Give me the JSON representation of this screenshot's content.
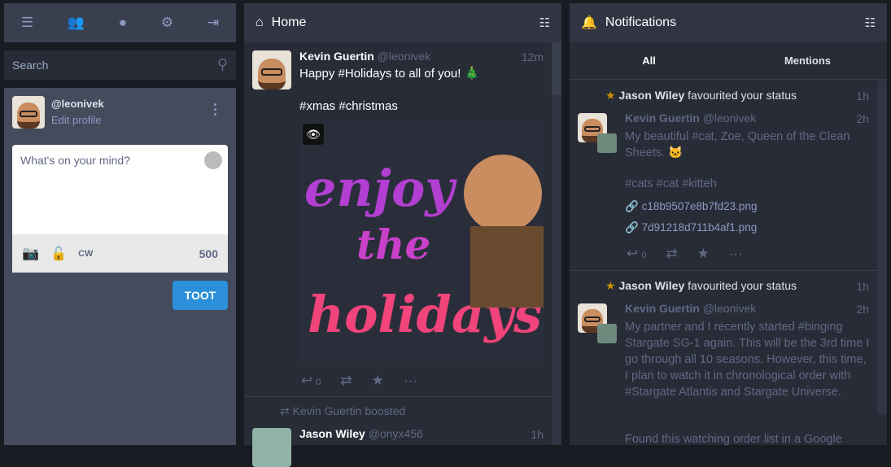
{
  "nav": {
    "icons": [
      "menu-icon",
      "users-icon",
      "globe-icon",
      "gear-icon",
      "logout-icon"
    ]
  },
  "search": {
    "placeholder": "Search"
  },
  "profile": {
    "handle": "@leonivek",
    "edit": "Edit profile"
  },
  "compose": {
    "placeholder": "What's on your mind?",
    "cw": "CW",
    "count": "500",
    "toot": "TOOT"
  },
  "home": {
    "title": "Home",
    "post": {
      "name": "Kevin Guertin",
      "handle": "@leonivek",
      "time": "12m",
      "text": "Happy #Holidays to all of you! 🎄",
      "tags": "#xmas #christmas",
      "image_text": [
        "enjoy",
        "the",
        "holidays"
      ],
      "replies": "0"
    },
    "boost": {
      "label": "Kevin Guertin boosted",
      "name": "Jason Wiley",
      "handle": "@onyx456",
      "time": "1h"
    }
  },
  "notifications": {
    "title": "Notifications",
    "tabs": [
      "All",
      "Mentions"
    ],
    "items": [
      {
        "actor": "Jason Wiley",
        "action": "favourited your status",
        "time": "1h",
        "name": "Kevin Guertin",
        "handle": "@leonivek",
        "ptime": "2h",
        "text": "My beautiful #cat, Zoe, Queen of the Clean Sheets. 🐱",
        "tags": "#cats #cat #kitteh",
        "links": [
          "c18b9507e8b7fd23.png",
          "7d91218d711b4af1.png"
        ],
        "replies": "0"
      },
      {
        "actor": "Jason Wiley",
        "action": "favourited your status",
        "time": "1h",
        "name": "Kevin Guertin",
        "handle": "@leonivek",
        "ptime": "2h",
        "text": "My partner and I recently started #binging Stargate SG-1 again. This will be the 3rd time I go through all 10 seasons. However, this time, I plan to watch it in chronological order with #Stargate Atlantis and Stargate Universe.",
        "text2": "Found this watching order list in a Google"
      }
    ]
  }
}
